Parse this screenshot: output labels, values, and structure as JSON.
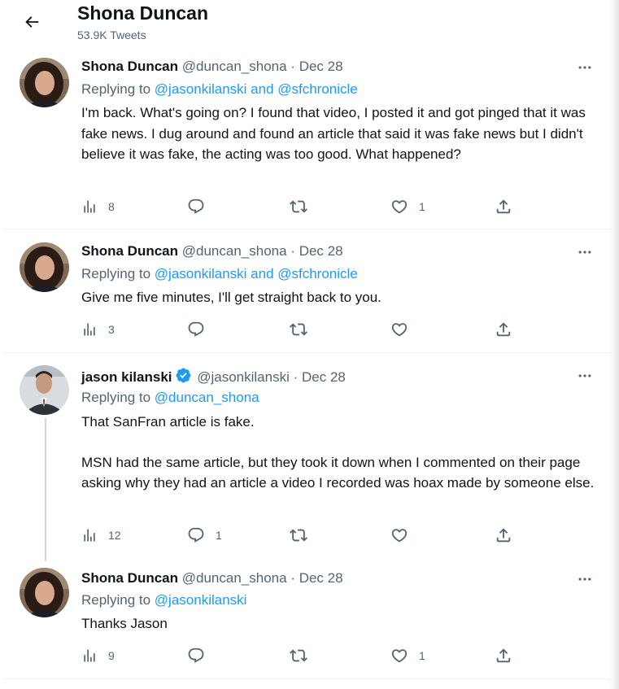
{
  "header": {
    "title": "Shona Duncan",
    "tweet_count": "53.9K Tweets"
  },
  "tweets": [
    {
      "name": "Shona Duncan",
      "handle": "@duncan_shona",
      "separator": "·",
      "date": "Dec 28",
      "replying_prefix": "Replying to",
      "replying_to": "@jasonkilanski and @sfchronicle",
      "text": [
        "I'm back.  What's going on?  I found that video, I posted it and got pinged that it was fake news.  I dug around and found an article that said it was fake news but I didn't believe it was fake, the acting was too good.  What happened?"
      ],
      "views": "8",
      "replies": "",
      "retweets": "",
      "likes": "1"
    },
    {
      "name": "Shona Duncan",
      "handle": "@duncan_shona",
      "separator": "·",
      "date": "Dec 28",
      "replying_prefix": "Replying to",
      "replying_to": "@jasonkilanski and @sfchronicle",
      "text": [
        "Give me five minutes, I'll get straight back to you."
      ],
      "views": "3",
      "replies": "",
      "retweets": "",
      "likes": ""
    },
    {
      "name": "jason kilanski",
      "verified": true,
      "handle": "@jasonkilanski",
      "separator": "·",
      "date": "Dec 28",
      "replying_prefix": "Replying to",
      "replying_to": "@duncan_shona",
      "text": [
        "That SanFran article is fake.",
        "MSN had the same article, but they took it down when I commented on their page asking why they had an article a video I recorded was hoax made by someone else."
      ],
      "views": "12",
      "replies": "1",
      "retweets": "",
      "likes": ""
    },
    {
      "name": "Shona Duncan",
      "handle": "@duncan_shona",
      "separator": "·",
      "date": "Dec 28",
      "replying_prefix": "Replying to",
      "replying_to": "@jasonkilanski",
      "text": [
        "Thanks Jason"
      ],
      "views": "9",
      "replies": "",
      "retweets": "",
      "likes": "1"
    }
  ],
  "icons": {
    "back": "arrow-left-icon",
    "more": "more-horizontal-icon",
    "views": "analytics-icon",
    "reply": "reply-icon",
    "retweet": "retweet-icon",
    "like": "heart-icon",
    "share": "share-icon",
    "verified": "verified-badge-icon"
  },
  "colors": {
    "link": "#1d9bf0",
    "secondary_text": "#536471",
    "primary_text": "#0f1419",
    "divider": "#eff3f4"
  }
}
